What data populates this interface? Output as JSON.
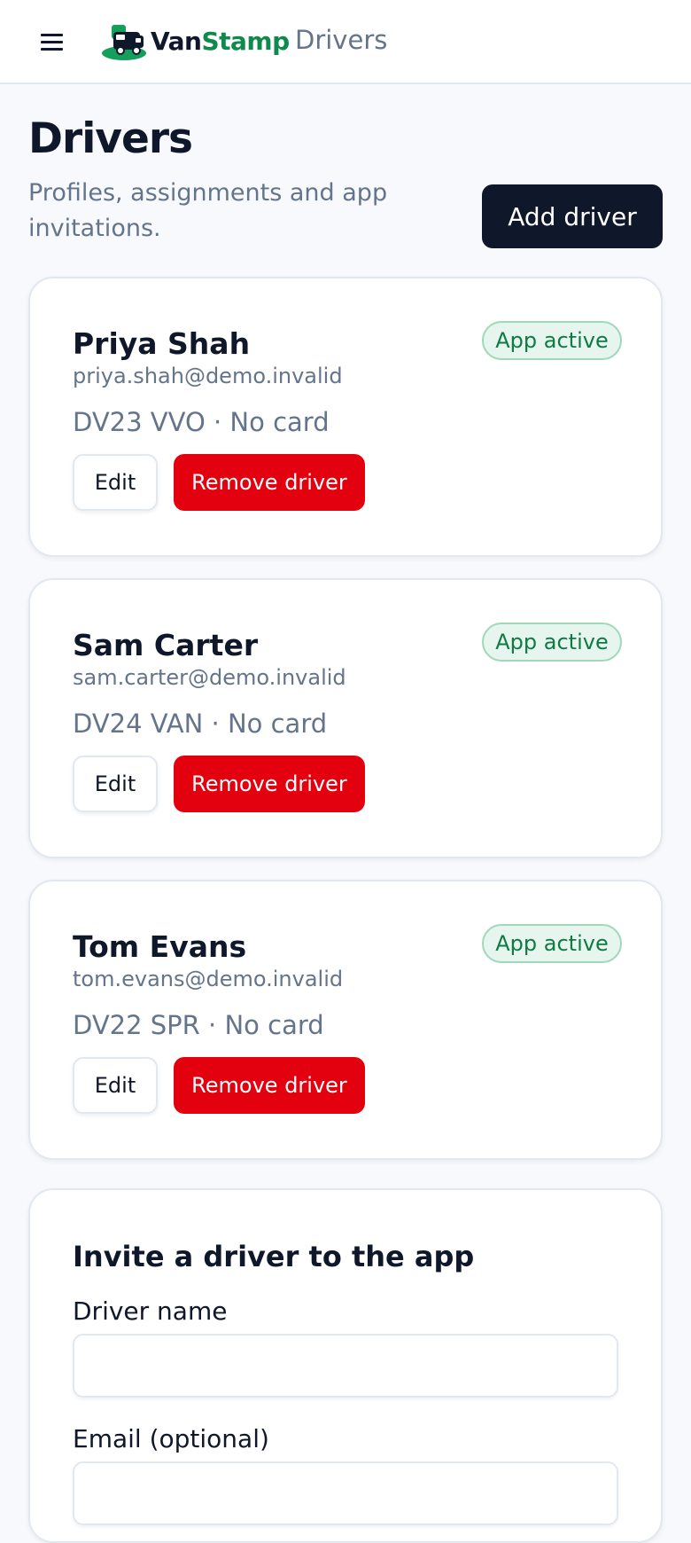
{
  "header": {
    "brand_part1": "Van",
    "brand_part2": "Stamp",
    "section": "Drivers",
    "logo_icon": "van-logo-icon",
    "menu_icon": "hamburger-icon"
  },
  "page": {
    "title": "Drivers",
    "subtitle": "Profiles, assignments and app invitations.",
    "add_button": "Add driver"
  },
  "drivers": [
    {
      "name": "Priya Shah",
      "email": "priya.shah@demo.invalid",
      "meta": "DV23 VVO · No card",
      "badge": "App active",
      "edit": "Edit",
      "remove": "Remove driver"
    },
    {
      "name": "Sam Carter",
      "email": "sam.carter@demo.invalid",
      "meta": "DV24 VAN · No card",
      "badge": "App active",
      "edit": "Edit",
      "remove": "Remove driver"
    },
    {
      "name": "Tom Evans",
      "email": "tom.evans@demo.invalid",
      "meta": "DV22 SPR · No card",
      "badge": "App active",
      "edit": "Edit",
      "remove": "Remove driver"
    }
  ],
  "invite": {
    "title": "Invite a driver to the app",
    "name_label": "Driver name",
    "name_value": "",
    "email_label": "Email (optional)",
    "email_value": ""
  },
  "colors": {
    "accent_dark": "#0f172a",
    "brand_green": "#0f8a4c",
    "danger": "#e3000f",
    "badge_bg": "#e6f6ee"
  }
}
